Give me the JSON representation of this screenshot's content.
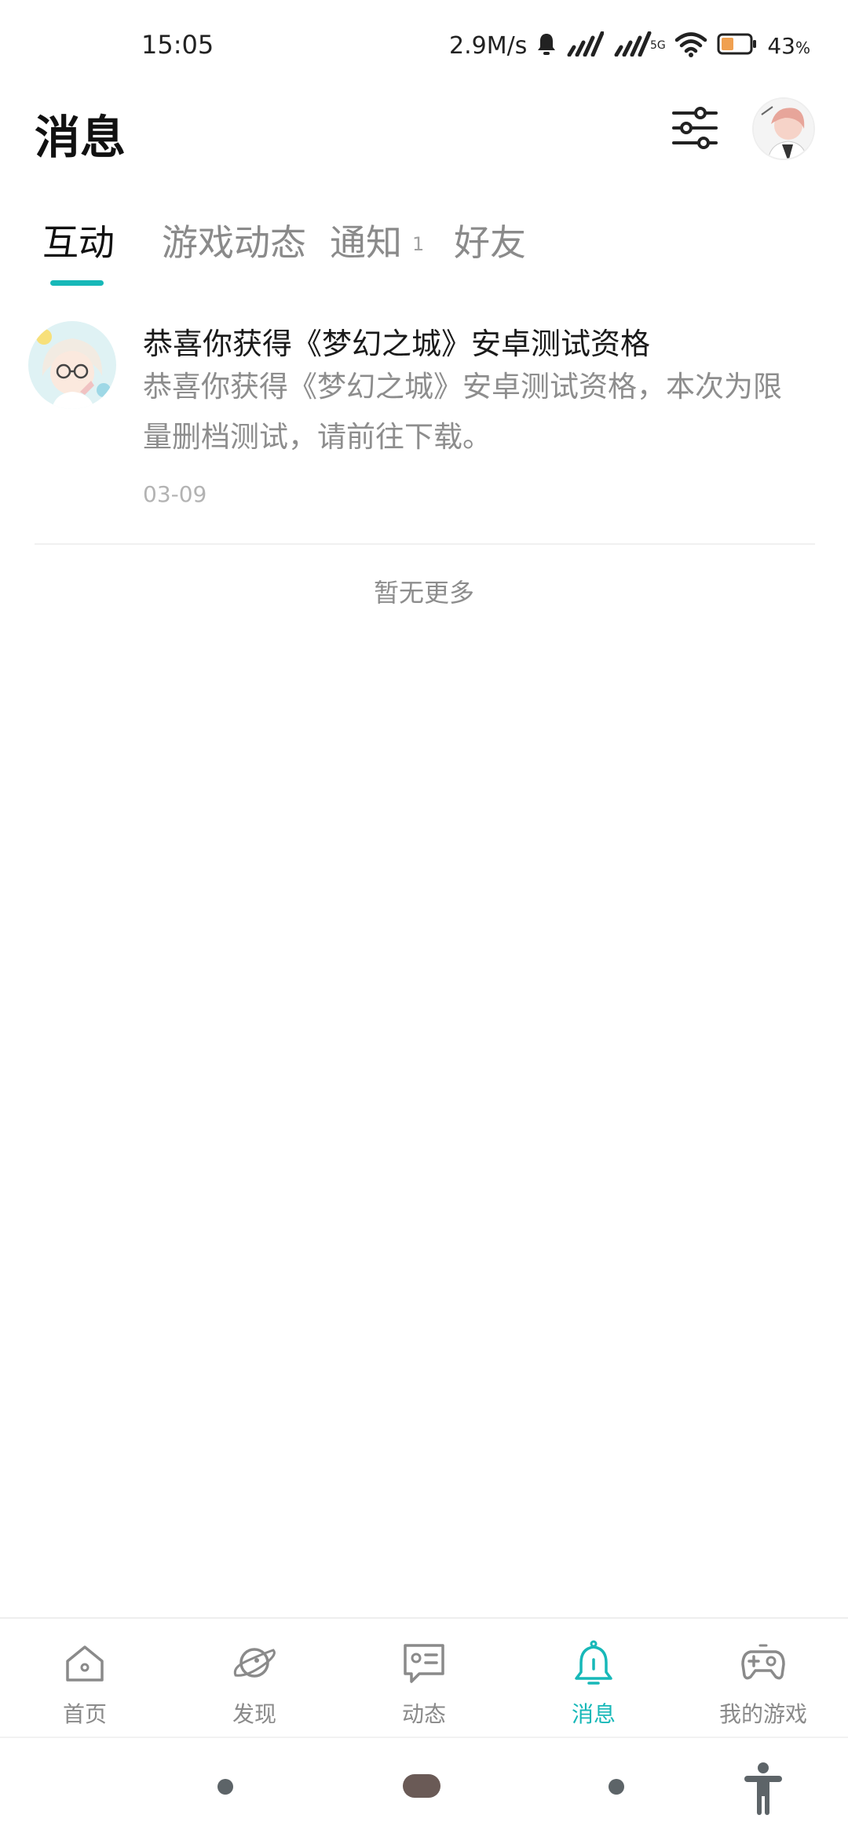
{
  "status_bar": {
    "time": "15:05",
    "net_speed": "2.9M/s",
    "battery_value": "43",
    "battery_unit": "%",
    "battery_level": 0.43
  },
  "header": {
    "title": "消息"
  },
  "tabs": [
    {
      "label": "互动",
      "active": true
    },
    {
      "label": "游戏动态",
      "active": false
    },
    {
      "label": "通知",
      "active": false,
      "badge": "1"
    },
    {
      "label": "好友",
      "active": false
    }
  ],
  "messages": [
    {
      "title": "恭喜你获得《梦幻之城》安卓测试资格",
      "body": "恭喜你获得《梦幻之城》安卓测试资格，本次为限量删档测试，请前往下载。",
      "date": "03-09"
    }
  ],
  "list_footer": "暂无更多",
  "bottom_nav": [
    {
      "label": "首页",
      "icon": "home-icon",
      "active": false
    },
    {
      "label": "发现",
      "icon": "planet-icon",
      "active": false
    },
    {
      "label": "动态",
      "icon": "feed-icon",
      "active": false
    },
    {
      "label": "消息",
      "icon": "bell-icon",
      "active": true
    },
    {
      "label": "我的游戏",
      "icon": "gamepad-icon",
      "active": false
    }
  ],
  "colors": {
    "accent": "#17b8b8",
    "text_primary": "#1a1a1a",
    "text_secondary": "#8d8d8d"
  }
}
